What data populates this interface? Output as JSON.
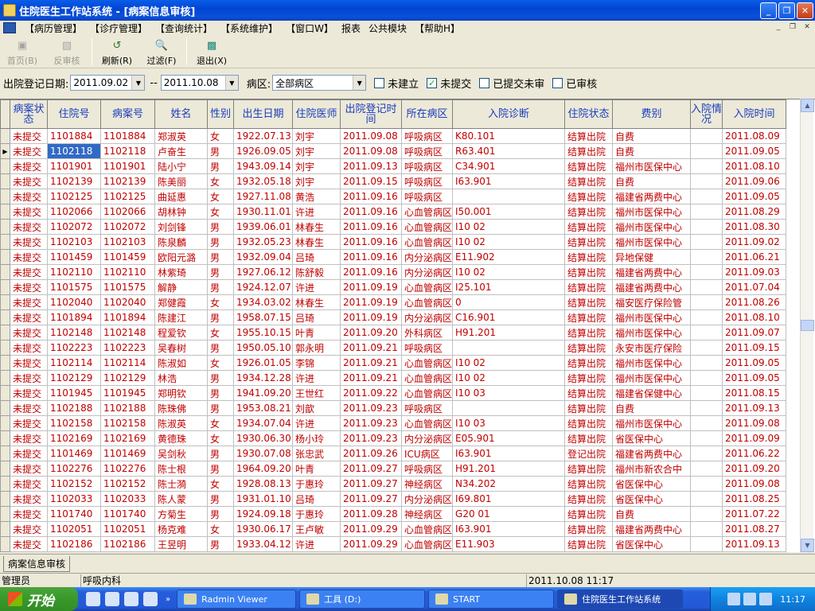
{
  "window": {
    "title": "住院医生工作站系统 - [病案信息审核]"
  },
  "menu": [
    "【病历管理】",
    "【诊疗管理】",
    "【查询统计】",
    "【系统维护】",
    "【窗口W】",
    "报表",
    "公共模块",
    "【帮助H】"
  ],
  "toolbar": {
    "first": "首页(B)",
    "unreview": "反审核",
    "refresh": "刷新(R)",
    "filter": "过滤(F)",
    "exit": "退出(X)"
  },
  "filter": {
    "date_label": "出院登记日期:",
    "date_from": "2011.09.02",
    "sep": "--",
    "date_to": "2011.10.08",
    "ward_label": "病区:",
    "ward": "全部病区",
    "chk_unbuilt": "未建立",
    "chk_unsubmitted": "未提交",
    "chk_submitted_unreviewed": "已提交未审",
    "chk_reviewed": "已审核"
  },
  "columns": [
    "病案状态",
    "住院号",
    "病案号",
    "姓名",
    "性别",
    "出生日期",
    "住院医师",
    "出院登记时间",
    "所在病区",
    "入院诊断",
    "住院状态",
    "费别",
    "入院情况",
    "入院时间"
  ],
  "rows": [
    [
      "未提交",
      "1101884",
      "1101884",
      "郑淑英",
      "女",
      "1922.07.13",
      "刘宇",
      "2011.09.08",
      "呼吸病区",
      "K80.101",
      "结算出院",
      "自费",
      "",
      "2011.08.09"
    ],
    [
      "未提交",
      "1102118",
      "1102118",
      "卢奋生",
      "男",
      "1926.09.05",
      "刘宇",
      "2011.09.08",
      "呼吸病区",
      "R63.401",
      "结算出院",
      "自费",
      "",
      "2011.09.05"
    ],
    [
      "未提交",
      "1101901",
      "1101901",
      "陆小宁",
      "男",
      "1943.09.14",
      "刘宇",
      "2011.09.13",
      "呼吸病区",
      "C34.901",
      "结算出院",
      "福州市医保中心",
      "",
      "2011.08.10"
    ],
    [
      "未提交",
      "1102139",
      "1102139",
      "陈美丽",
      "女",
      "1932.05.18",
      "刘宇",
      "2011.09.15",
      "呼吸病区",
      "I63.901",
      "结算出院",
      "自费",
      "",
      "2011.09.06"
    ],
    [
      "未提交",
      "1102125",
      "1102125",
      "曲延惠",
      "女",
      "1927.11.08",
      "黄浩",
      "2011.09.16",
      "呼吸病区",
      "",
      "结算出院",
      "福建省两费中心",
      "",
      "2011.09.05"
    ],
    [
      "未提交",
      "1102066",
      "1102066",
      "胡林钟",
      "女",
      "1930.11.01",
      "许进",
      "2011.09.16",
      "心血管病区",
      "I50.001",
      "结算出院",
      "福州市医保中心",
      "",
      "2011.08.29"
    ],
    [
      "未提交",
      "1102072",
      "1102072",
      "刘剑锋",
      "男",
      "1939.06.01",
      "林春生",
      "2011.09.16",
      "心血管病区",
      "I10 02",
      "结算出院",
      "福州市医保中心",
      "",
      "2011.08.30"
    ],
    [
      "未提交",
      "1102103",
      "1102103",
      "陈泉麟",
      "男",
      "1932.05.23",
      "林春生",
      "2011.09.16",
      "心血管病区",
      "I10 02",
      "结算出院",
      "福州市医保中心",
      "",
      "2011.09.02"
    ],
    [
      "未提交",
      "1101459",
      "1101459",
      "欧阳元潞",
      "男",
      "1932.09.04",
      "吕琦",
      "2011.09.16",
      "内分泌病区",
      "E11.902",
      "结算出院",
      "异地保健",
      "",
      "2011.06.21"
    ],
    [
      "未提交",
      "1102110",
      "1102110",
      "林紫琦",
      "男",
      "1927.06.12",
      "陈舒毅",
      "2011.09.16",
      "内分泌病区",
      "I10 02",
      "结算出院",
      "福建省两费中心",
      "",
      "2011.09.03"
    ],
    [
      "未提交",
      "1101575",
      "1101575",
      "解静",
      "男",
      "1924.12.07",
      "许进",
      "2011.09.19",
      "心血管病区",
      "I25.101",
      "结算出院",
      "福建省两费中心",
      "",
      "2011.07.04"
    ],
    [
      "未提交",
      "1102040",
      "1102040",
      "郑健霞",
      "女",
      "1934.03.02",
      "林春生",
      "2011.09.19",
      "心血管病区",
      "0",
      "结算出院",
      "福安医疗保险管",
      "",
      "2011.08.26"
    ],
    [
      "未提交",
      "1101894",
      "1101894",
      "陈建江",
      "男",
      "1958.07.15",
      "吕琦",
      "2011.09.19",
      "内分泌病区",
      "C16.901",
      "结算出院",
      "福州市医保中心",
      "",
      "2011.08.10"
    ],
    [
      "未提交",
      "1102148",
      "1102148",
      "程爱钦",
      "女",
      "1955.10.15",
      "叶青",
      "2011.09.20",
      "外科病区",
      "H91.201",
      "结算出院",
      "福州市医保中心",
      "",
      "2011.09.07"
    ],
    [
      "未提交",
      "1102223",
      "1102223",
      "吴春树",
      "男",
      "1950.05.10",
      "郭永明",
      "2011.09.21",
      "呼吸病区",
      "",
      "结算出院",
      "永安市医疗保险",
      "",
      "2011.09.15"
    ],
    [
      "未提交",
      "1102114",
      "1102114",
      "陈淑如",
      "女",
      "1926.01.05",
      "李锦",
      "2011.09.21",
      "心血管病区",
      "I10 02",
      "结算出院",
      "福州市医保中心",
      "",
      "2011.09.05"
    ],
    [
      "未提交",
      "1102129",
      "1102129",
      "林浩",
      "男",
      "1934.12.28",
      "许进",
      "2011.09.21",
      "心血管病区",
      "I10 02",
      "结算出院",
      "福州市医保中心",
      "",
      "2011.09.05"
    ],
    [
      "未提交",
      "1101945",
      "1101945",
      "郑明钦",
      "男",
      "1941.09.20",
      "王世红",
      "2011.09.22",
      "心血管病区",
      "I10 03",
      "结算出院",
      "福建省保健中心",
      "",
      "2011.08.15"
    ],
    [
      "未提交",
      "1102188",
      "1102188",
      "陈珠佛",
      "男",
      "1953.08.21",
      "刘歆",
      "2011.09.23",
      "呼吸病区",
      "",
      "结算出院",
      "自费",
      "",
      "2011.09.13"
    ],
    [
      "未提交",
      "1102158",
      "1102158",
      "陈淑英",
      "女",
      "1934.07.04",
      "许进",
      "2011.09.23",
      "心血管病区",
      "I10 03",
      "结算出院",
      "福州市医保中心",
      "",
      "2011.09.08"
    ],
    [
      "未提交",
      "1102169",
      "1102169",
      "黄德珠",
      "女",
      "1930.06.30",
      "杨小玲",
      "2011.09.23",
      "内分泌病区",
      "E05.901",
      "结算出院",
      "省医保中心",
      "",
      "2011.09.09"
    ],
    [
      "未提交",
      "1101469",
      "1101469",
      "吴剑秋",
      "男",
      "1930.07.08",
      "张忠武",
      "2011.09.26",
      "ICU病区",
      "I63.901",
      "登记出院",
      "福建省两费中心",
      "",
      "2011.06.22"
    ],
    [
      "未提交",
      "1102276",
      "1102276",
      "陈士根",
      "男",
      "1964.09.20",
      "叶青",
      "2011.09.27",
      "呼吸病区",
      "H91.201",
      "结算出院",
      "福州市新农合中",
      "",
      "2011.09.20"
    ],
    [
      "未提交",
      "1102152",
      "1102152",
      "陈士漪",
      "女",
      "1928.08.13",
      "于惠玲",
      "2011.09.27",
      "神经病区",
      "N34.202",
      "结算出院",
      "省医保中心",
      "",
      "2011.09.08"
    ],
    [
      "未提交",
      "1102033",
      "1102033",
      "陈人蒙",
      "男",
      "1931.01.10",
      "吕琦",
      "2011.09.27",
      "内分泌病区",
      "I69.801",
      "结算出院",
      "省医保中心",
      "",
      "2011.08.25"
    ],
    [
      "未提交",
      "1101740",
      "1101740",
      "方菊生",
      "男",
      "1924.09.18",
      "于惠玲",
      "2011.09.28",
      "神经病区",
      "G20 01",
      "结算出院",
      "自费",
      "",
      "2011.07.22"
    ],
    [
      "未提交",
      "1102051",
      "1102051",
      "杨克难",
      "女",
      "1930.06.17",
      "王卢敏",
      "2011.09.29",
      "心血管病区",
      "I63.901",
      "结算出院",
      "福建省两费中心",
      "",
      "2011.08.27"
    ],
    [
      "未提交",
      "1102186",
      "1102186",
      "王昱明",
      "男",
      "1933.04.12",
      "许进",
      "2011.09.29",
      "心血管病区",
      "E11.903",
      "结算出院",
      "省医保中心",
      "",
      "2011.09.13"
    ]
  ],
  "tab": "病案信息审核",
  "status": {
    "user": "管理员",
    "dept": "呼吸内科",
    "datetime": "2011.10.08 11:17"
  },
  "taskbar": {
    "start": "开始",
    "tasks": [
      "Radmin Viewer",
      "工具 (D:)",
      "START",
      "住院医生工作站系统"
    ],
    "clock": "11:17"
  },
  "colors": {
    "cell_text": "#c00000",
    "header_text": "#1a3cc0",
    "selection": "#316ac5"
  }
}
